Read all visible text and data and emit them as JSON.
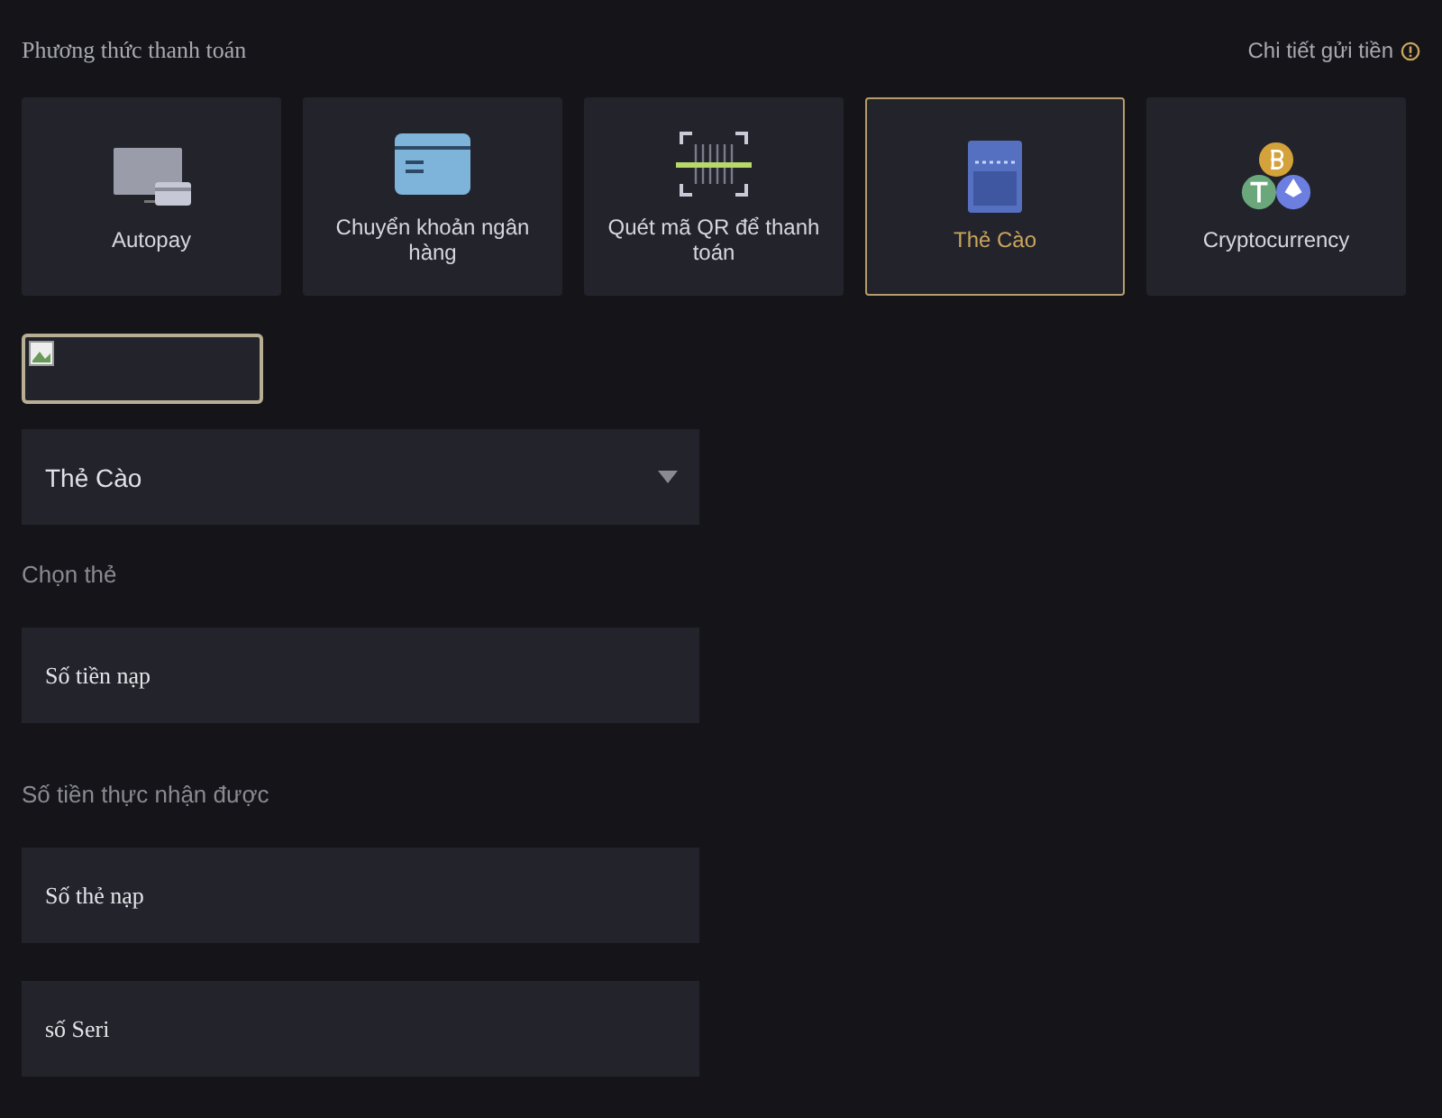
{
  "header": {
    "title": "Phương thức thanh toán",
    "details_link": "Chi tiết gửi tiền"
  },
  "methods": [
    {
      "kind": "monitor",
      "label": "Autopay",
      "selected": false
    },
    {
      "kind": "card",
      "label": "Chuyển khoản ngân hàng",
      "selected": false
    },
    {
      "kind": "qr",
      "label": "Quét mã QR để thanh toán",
      "selected": false
    },
    {
      "kind": "scratch",
      "label": "Thẻ Cào",
      "selected": true
    },
    {
      "kind": "crypto",
      "label": "Cryptocurrency",
      "selected": false
    }
  ],
  "card_select": {
    "value": "Thẻ Cào",
    "label": "Chọn thẻ"
  },
  "amount_field": {
    "placeholder": "Số tiền nạp"
  },
  "received_label": "Số tiền thực nhận được",
  "card_number_field": {
    "placeholder": "Số thẻ nạp"
  },
  "serial_field": {
    "placeholder": "số Seri"
  }
}
